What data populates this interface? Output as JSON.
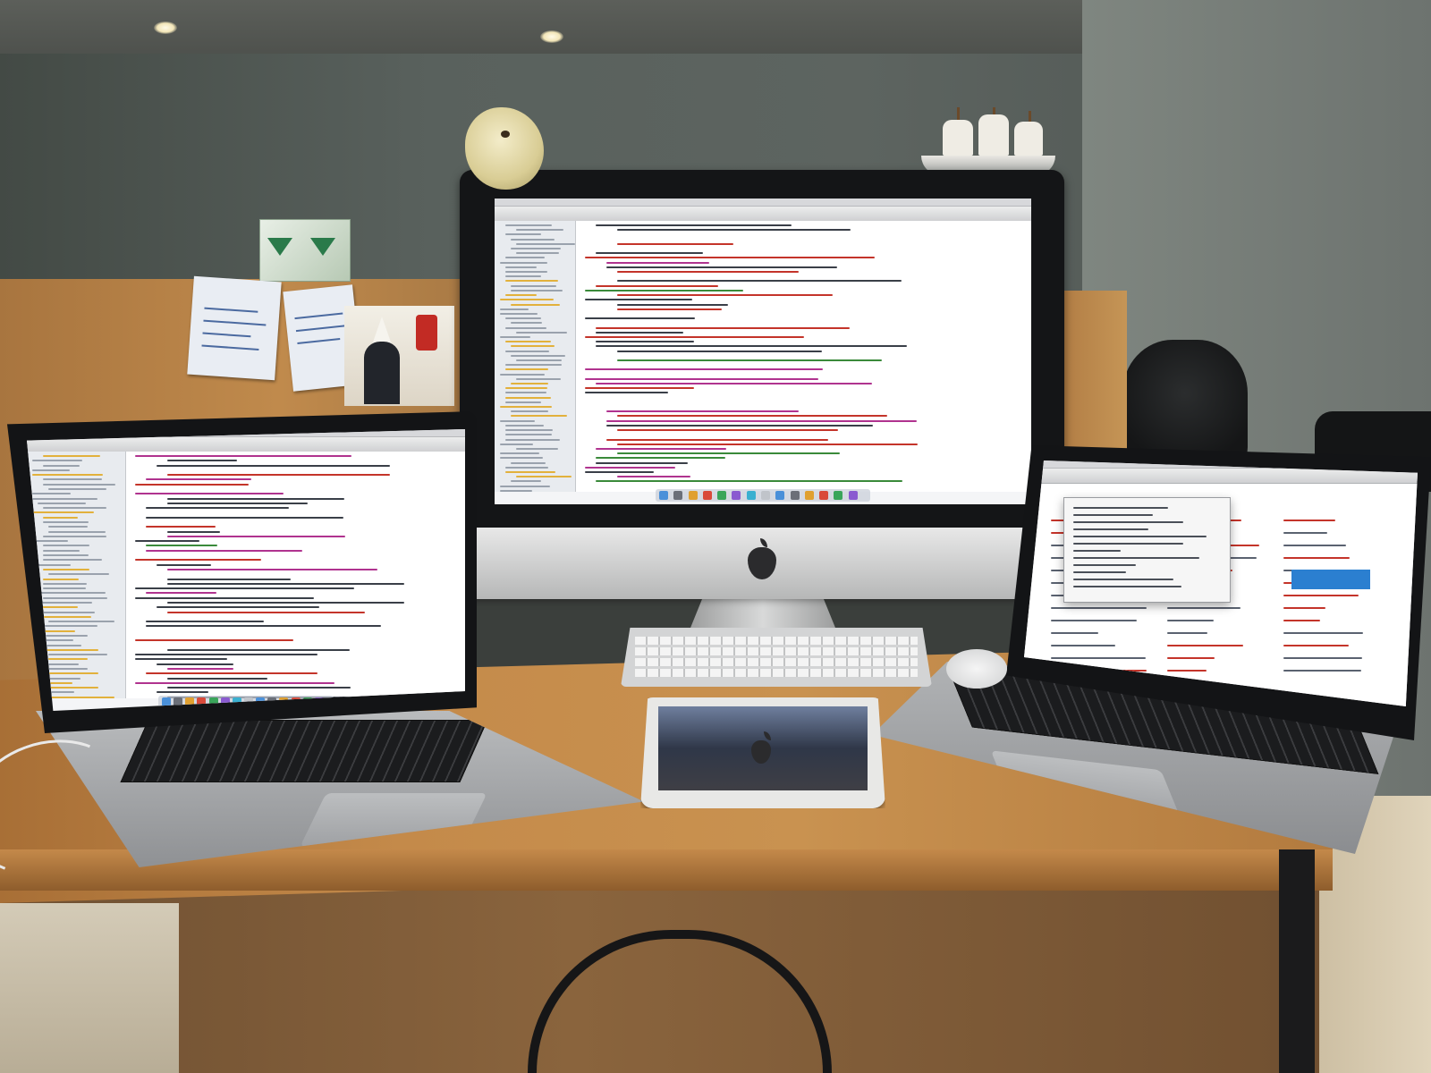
{
  "scene": {
    "colors": {
      "wall": "#5d6460",
      "desk": "#c48a4a",
      "screen_bg": "#f4f5f7",
      "code_keyword": "#b0338f",
      "code_string": "#c4342a",
      "code_comment": "#3a8a3a",
      "code_plain": "#3a3f48",
      "folder": "#e2b13c"
    },
    "objects": [
      "ceiling-light-icon",
      "plush-toy-icon",
      "ship-model-icon",
      "sticky-note-icon",
      "poster-icon",
      "imac-icon",
      "apple-logo-icon",
      "laptop-icon",
      "ipad-icon",
      "keyboard-icon",
      "mouse-icon",
      "office-chair-icon"
    ]
  }
}
